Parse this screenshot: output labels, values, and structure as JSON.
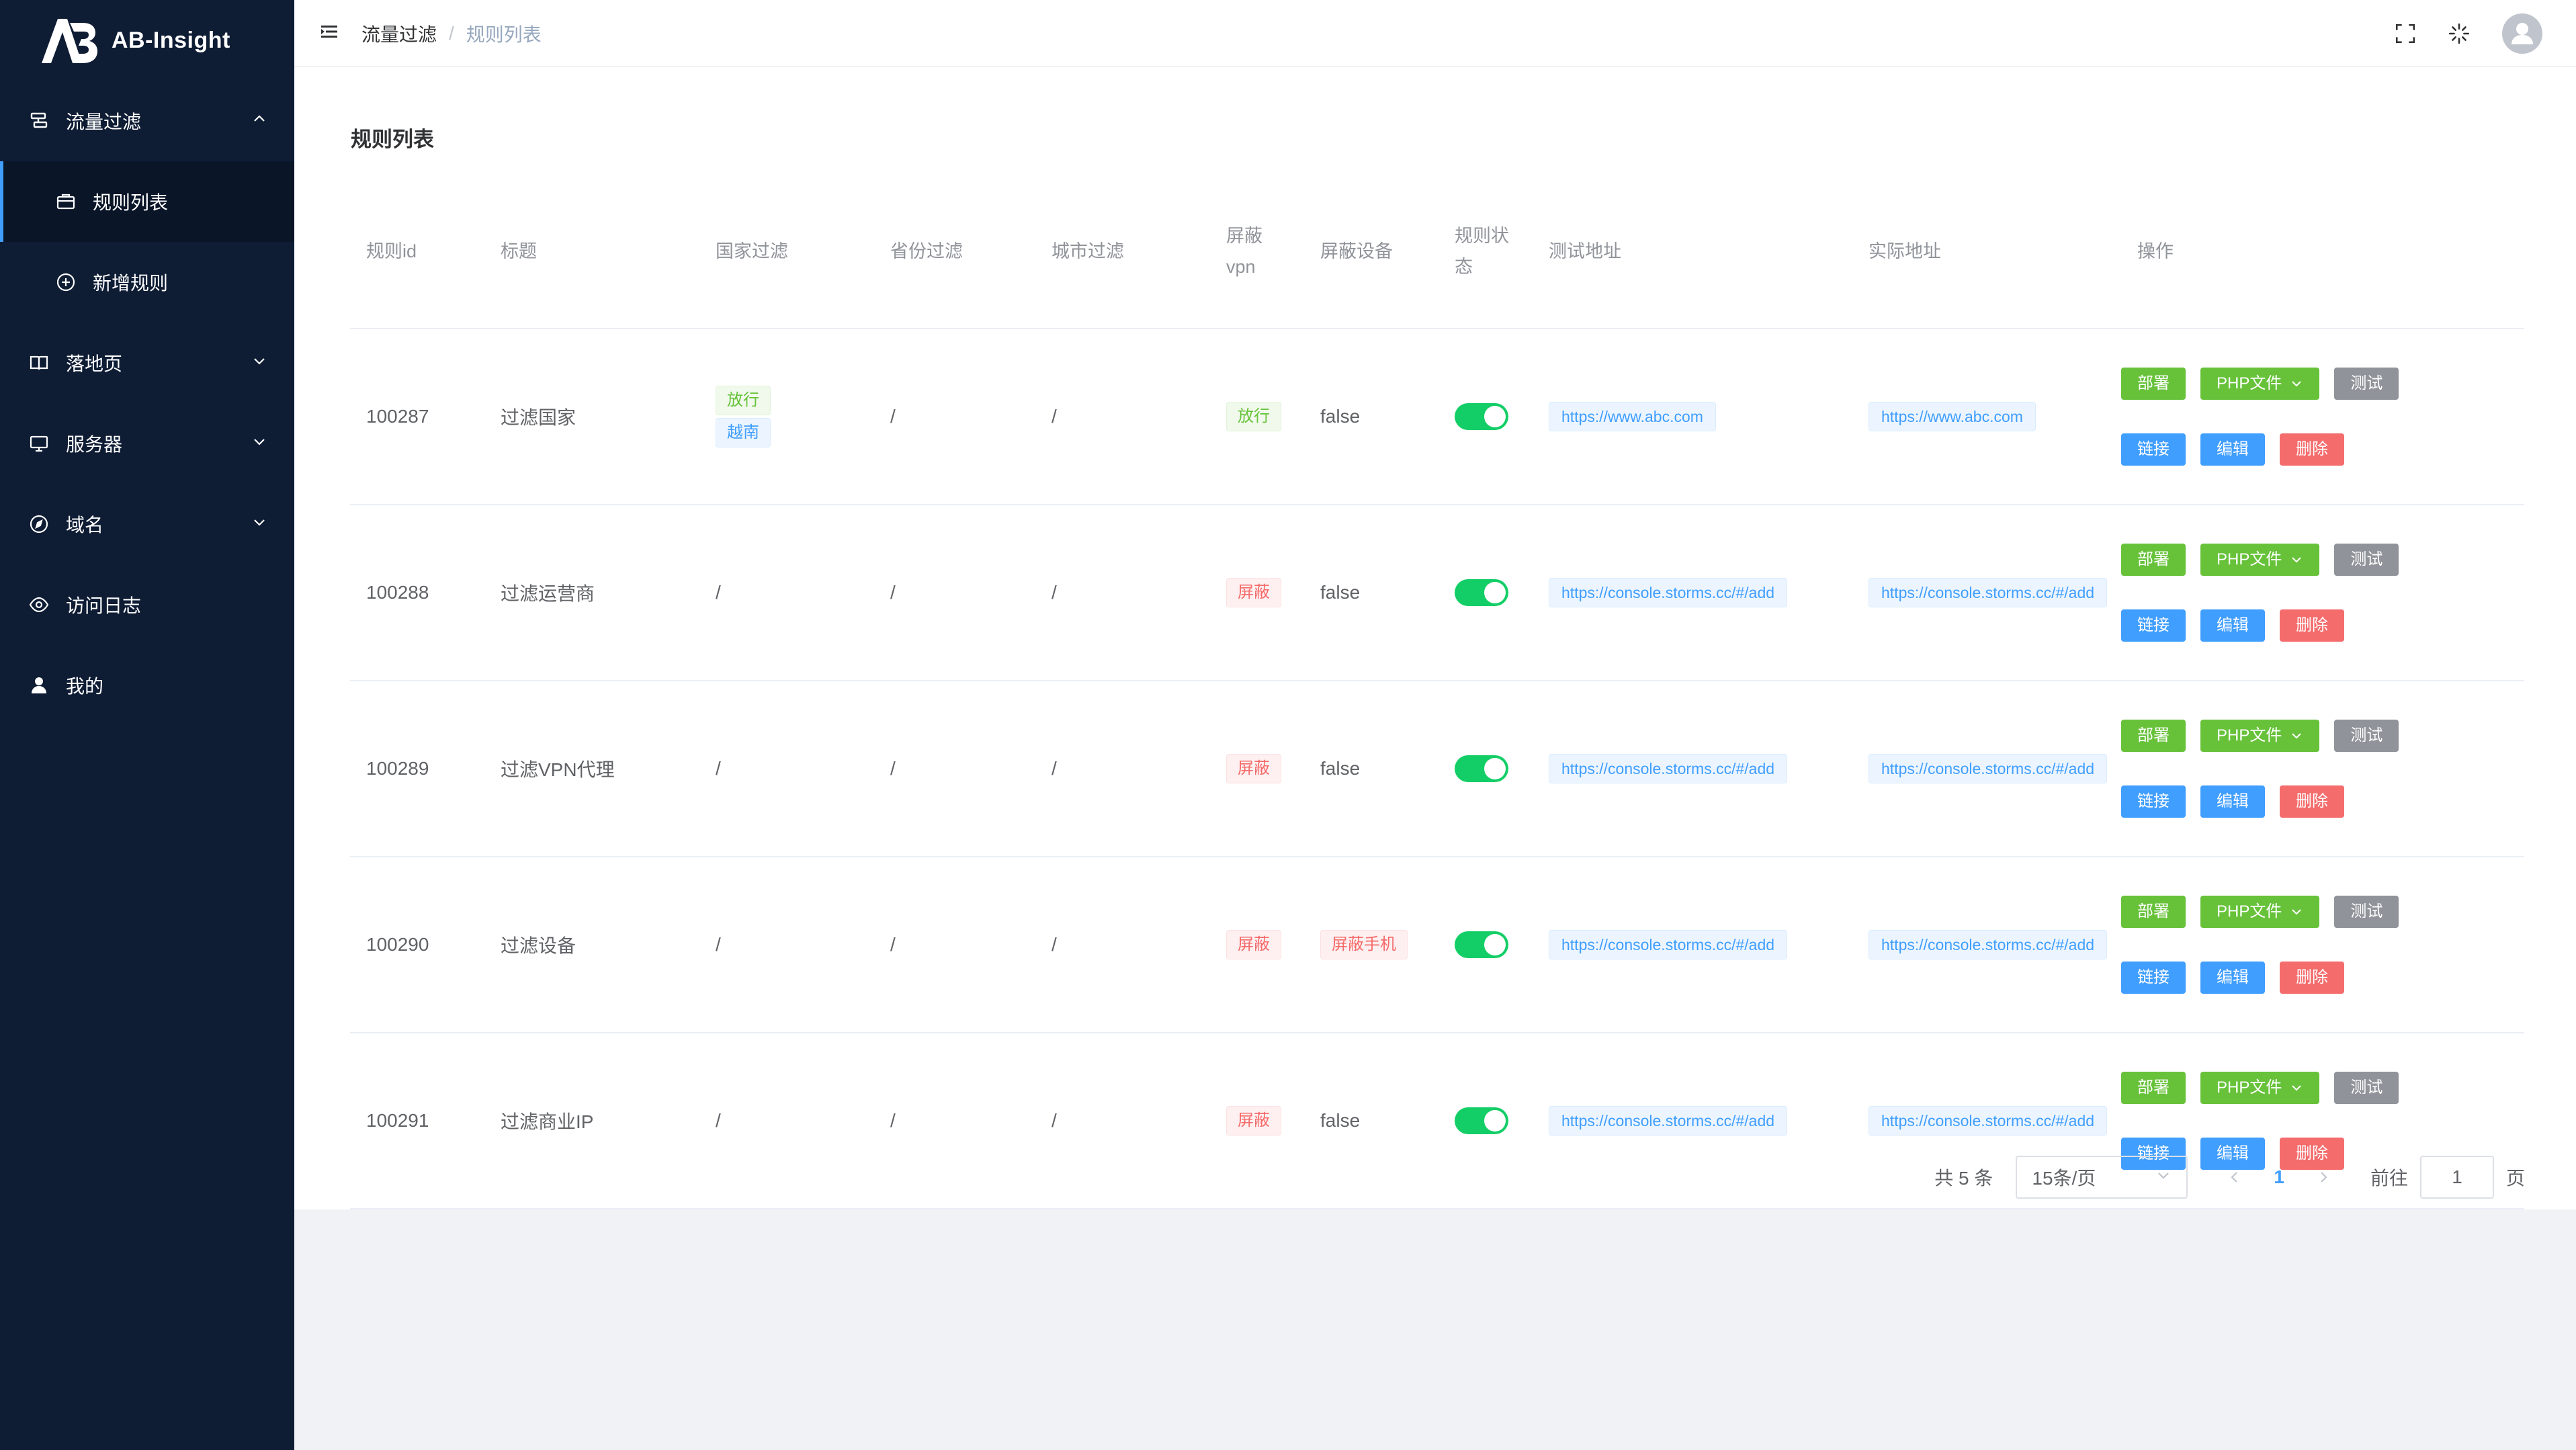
{
  "app": {
    "name": "AB-Insight"
  },
  "sidebar": {
    "items": [
      {
        "label": "流量过滤",
        "icon": "filter-icon",
        "expanded": true,
        "children": [
          {
            "label": "规则列表",
            "icon": "briefcase-icon",
            "active": true
          },
          {
            "label": "新增规则",
            "icon": "plus-circle-icon"
          }
        ]
      },
      {
        "label": "落地页",
        "icon": "book-icon"
      },
      {
        "label": "服务器",
        "icon": "monitor-icon"
      },
      {
        "label": "域名",
        "icon": "compass-icon"
      },
      {
        "label": "访问日志",
        "icon": "eye-icon"
      },
      {
        "label": "我的",
        "icon": "user-icon"
      }
    ]
  },
  "header": {
    "breadcrumb": [
      "流量过滤",
      "规则列表"
    ],
    "separator": "/"
  },
  "page": {
    "title": "规则列表"
  },
  "table": {
    "columns": {
      "id": "规则id",
      "title": "标题",
      "country": "国家过滤",
      "province": "省份过滤",
      "city": "城市过滤",
      "vpn_line1": "屏蔽",
      "vpn_line2": "vpn",
      "device": "屏蔽设备",
      "status_line1": "规则状",
      "status_line2": "态",
      "test_url": "测试地址",
      "real_url": "实际地址",
      "ops": "操作"
    },
    "rows": [
      {
        "id": "100287",
        "title": "过滤国家",
        "country_tags": [
          "放行",
          "越南"
        ],
        "province": "/",
        "city": "/",
        "vpn": "放行",
        "device": "false",
        "test_url": "https://www.abc.com",
        "real_url": "https://www.abc.com",
        "enabled": true
      },
      {
        "id": "100288",
        "title": "过滤运营商",
        "country": "/",
        "province": "/",
        "city": "/",
        "vpn": "屏蔽",
        "device": "false",
        "test_url": "https://console.storms.cc/#/add",
        "real_url": "https://console.storms.cc/#/add",
        "enabled": true
      },
      {
        "id": "100289",
        "title": "过滤VPN代理",
        "country": "/",
        "province": "/",
        "city": "/",
        "vpn": "屏蔽",
        "device": "false",
        "test_url": "https://console.storms.cc/#/add",
        "real_url": "https://console.storms.cc/#/add",
        "enabled": true
      },
      {
        "id": "100290",
        "title": "过滤设备",
        "country": "/",
        "province": "/",
        "city": "/",
        "vpn": "屏蔽",
        "device_tag": "屏蔽手机",
        "test_url": "https://console.storms.cc/#/add",
        "real_url": "https://console.storms.cc/#/add",
        "enabled": true
      },
      {
        "id": "100291",
        "title": "过滤商业IP",
        "country": "/",
        "province": "/",
        "city": "/",
        "vpn": "屏蔽",
        "device": "false",
        "test_url": "https://console.storms.cc/#/add",
        "real_url": "https://console.storms.cc/#/add",
        "enabled": true
      }
    ],
    "actions": {
      "deploy": "部署",
      "php_file": "PHP文件",
      "test": "测试",
      "link": "链接",
      "edit": "编辑",
      "delete": "删除"
    }
  },
  "pagination": {
    "total": "共 5 条",
    "page_size": "15条/页",
    "current_page": "1",
    "goto_label": "前往",
    "goto_value": "1",
    "page_suffix": "页"
  },
  "colors": {
    "sidebar_bg": "#0e1c34",
    "primary": "#409eff",
    "success": "#67c23a",
    "danger": "#f56c6c",
    "info": "#909399",
    "switch_on": "#13ce66"
  }
}
